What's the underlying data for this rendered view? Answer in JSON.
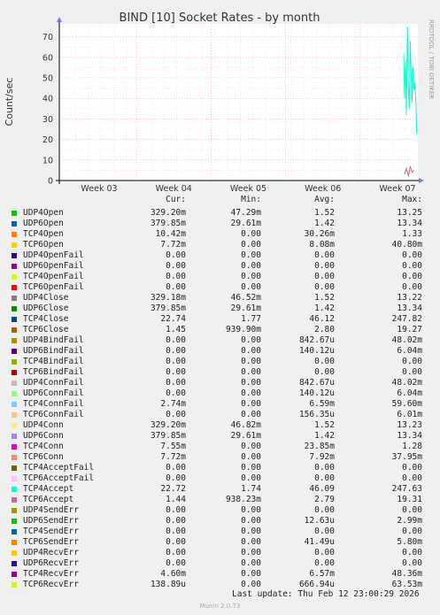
{
  "chart_data": {
    "type": "line",
    "title": "BIND [10] Socket Rates - by month",
    "ylabel": "Count/sec",
    "side_label": "RRDTOOL / TOBI OETIKER",
    "ylim": [
      0,
      75
    ],
    "yticks": [
      0,
      10,
      20,
      30,
      40,
      50,
      60,
      70
    ],
    "xticks": [
      "Week 03",
      "Week 04",
      "Week 05",
      "Week 06",
      "Week 07"
    ],
    "grid": true,
    "series": [
      {
        "name": "UDP4Open",
        "color": "#00cc00",
        "cur": "329.20m",
        "min": "47.29m",
        "avg": "1.52",
        "max": "13.25"
      },
      {
        "name": "UDP6Open",
        "color": "#0066b3",
        "cur": "379.85m",
        "min": "29.61m",
        "avg": "1.42",
        "max": "13.34"
      },
      {
        "name": "TCP4Open",
        "color": "#ff8000",
        "cur": "10.42m",
        "min": "0.00",
        "avg": "30.26m",
        "max": "1.33"
      },
      {
        "name": "TCP6Open",
        "color": "#ffcc00",
        "cur": "7.72m",
        "min": "0.00",
        "avg": "8.08m",
        "max": "40.80m"
      },
      {
        "name": "UDP4OpenFail",
        "color": "#330099",
        "cur": "0.00",
        "min": "0.00",
        "avg": "0.00",
        "max": "0.00"
      },
      {
        "name": "UDP6OpenFail",
        "color": "#990099",
        "cur": "0.00",
        "min": "0.00",
        "avg": "0.00",
        "max": "0.00"
      },
      {
        "name": "TCP4OpenFail",
        "color": "#ccff00",
        "cur": "0.00",
        "min": "0.00",
        "avg": "0.00",
        "max": "0.00"
      },
      {
        "name": "TCP6OpenFail",
        "color": "#ff0000",
        "cur": "0.00",
        "min": "0.00",
        "avg": "0.00",
        "max": "0.00"
      },
      {
        "name": "UDP4Close",
        "color": "#808080",
        "cur": "329.18m",
        "min": "46.52m",
        "avg": "1.52",
        "max": "13.22"
      },
      {
        "name": "UDP6Close",
        "color": "#008f00",
        "cur": "379.85m",
        "min": "29.61m",
        "avg": "1.42",
        "max": "13.34"
      },
      {
        "name": "TCP4Close",
        "color": "#00487d",
        "cur": "22.74",
        "min": "1.77",
        "avg": "46.12",
        "max": "247.82"
      },
      {
        "name": "TCP6Close",
        "color": "#b35a00",
        "cur": "1.45",
        "min": "939.90m",
        "avg": "2.80",
        "max": "19.27"
      },
      {
        "name": "UDP4BindFail",
        "color": "#b38f00",
        "cur": "0.00",
        "min": "0.00",
        "avg": "842.67u",
        "max": "48.02m"
      },
      {
        "name": "UDP6BindFail",
        "color": "#6b006b",
        "cur": "0.00",
        "min": "0.00",
        "avg": "140.12u",
        "max": "6.04m"
      },
      {
        "name": "TCP4BindFail",
        "color": "#8fb300",
        "cur": "0.00",
        "min": "0.00",
        "avg": "0.00",
        "max": "0.00"
      },
      {
        "name": "TCP6BindFail",
        "color": "#b30000",
        "cur": "0.00",
        "min": "0.00",
        "avg": "0.00",
        "max": "0.00"
      },
      {
        "name": "UDP4ConnFail",
        "color": "#bebebe",
        "cur": "0.00",
        "min": "0.00",
        "avg": "842.67u",
        "max": "48.02m"
      },
      {
        "name": "UDP6ConnFail",
        "color": "#80ff80",
        "cur": "0.00",
        "min": "0.00",
        "avg": "140.12u",
        "max": "6.04m"
      },
      {
        "name": "TCP4ConnFail",
        "color": "#80c9ff",
        "cur": "2.74m",
        "min": "0.00",
        "avg": "6.59m",
        "max": "59.60m"
      },
      {
        "name": "TCP6ConnFail",
        "color": "#ffc080",
        "cur": "0.00",
        "min": "0.00",
        "avg": "156.35u",
        "max": "6.01m"
      },
      {
        "name": "UDP4Conn",
        "color": "#ffe680",
        "cur": "329.20m",
        "min": "46.82m",
        "avg": "1.52",
        "max": "13.23"
      },
      {
        "name": "UDP6Conn",
        "color": "#aa80ff",
        "cur": "379.85m",
        "min": "29.61m",
        "avg": "1.42",
        "max": "13.34"
      },
      {
        "name": "TCP4Conn",
        "color": "#ee00cc",
        "cur": "7.55m",
        "min": "0.00",
        "avg": "23.85m",
        "max": "1.28"
      },
      {
        "name": "TCP6Conn",
        "color": "#ff8080",
        "cur": "7.72m",
        "min": "0.00",
        "avg": "7.92m",
        "max": "37.95m"
      },
      {
        "name": "TCP4AcceptFail",
        "color": "#666600",
        "cur": "0.00",
        "min": "0.00",
        "avg": "0.00",
        "max": "0.00"
      },
      {
        "name": "TCP6AcceptFail",
        "color": "#ffbfff",
        "cur": "0.00",
        "min": "0.00",
        "avg": "0.00",
        "max": "0.00"
      },
      {
        "name": "TCP4Accept",
        "color": "#00ffcc",
        "cur": "22.72",
        "min": "1.74",
        "avg": "46.09",
        "max": "247.63"
      },
      {
        "name": "TCP6Accept",
        "color": "#cc6699",
        "cur": "1.44",
        "min": "938.23m",
        "avg": "2.79",
        "max": "19.31"
      },
      {
        "name": "UDP4SendErr",
        "color": "#999900",
        "cur": "0.00",
        "min": "0.00",
        "avg": "0.00",
        "max": "0.00"
      },
      {
        "name": "UDP6SendErr",
        "color": "#00cc00",
        "cur": "0.00",
        "min": "0.00",
        "avg": "12.63u",
        "max": "2.99m"
      },
      {
        "name": "TCP4SendErr",
        "color": "#0066b3",
        "cur": "0.00",
        "min": "0.00",
        "avg": "0.00",
        "max": "0.00"
      },
      {
        "name": "TCP6SendErr",
        "color": "#ff8000",
        "cur": "0.00",
        "min": "0.00",
        "avg": "41.49u",
        "max": "5.80m"
      },
      {
        "name": "UDP4RecvErr",
        "color": "#ffcc00",
        "cur": "0.00",
        "min": "0.00",
        "avg": "0.00",
        "max": "0.00"
      },
      {
        "name": "UDP6RecvErr",
        "color": "#330099",
        "cur": "0.00",
        "min": "0.00",
        "avg": "0.00",
        "max": "0.00"
      },
      {
        "name": "TCP4RecvErr",
        "color": "#990099",
        "cur": "4.60m",
        "min": "0.00",
        "avg": "6.57m",
        "max": "48.36m"
      },
      {
        "name": "TCP6RecvErr",
        "color": "#ccff00",
        "cur": "138.89u",
        "min": "0.00",
        "avg": "666.94u",
        "max": "63.53m"
      }
    ],
    "plotted": {
      "TCP4Accept": {
        "x_week": [
          7.0,
          7.03,
          7.06,
          7.09,
          7.12,
          7.15,
          7.18,
          7.21,
          7.24,
          7.27,
          7.3,
          7.33,
          7.36,
          7.39,
          7.42
        ],
        "y": [
          62,
          40,
          58,
          32,
          75,
          45,
          35,
          68,
          52,
          38,
          55,
          44,
          48,
          40,
          23
        ]
      },
      "TCP6Accept": {
        "x_week": [
          7.03,
          7.09,
          7.15,
          7.21,
          7.27,
          7.33
        ],
        "y": [
          3,
          6,
          2,
          7,
          4,
          5
        ]
      }
    }
  },
  "legend_header": {
    "cur": "Cur:",
    "min": "Min:",
    "avg": "Avg:",
    "max": "Max:"
  },
  "footer": {
    "last_update": "Last update: Thu Feb 12 23:00:29 2026",
    "munin": "Munin 2.0.73"
  }
}
